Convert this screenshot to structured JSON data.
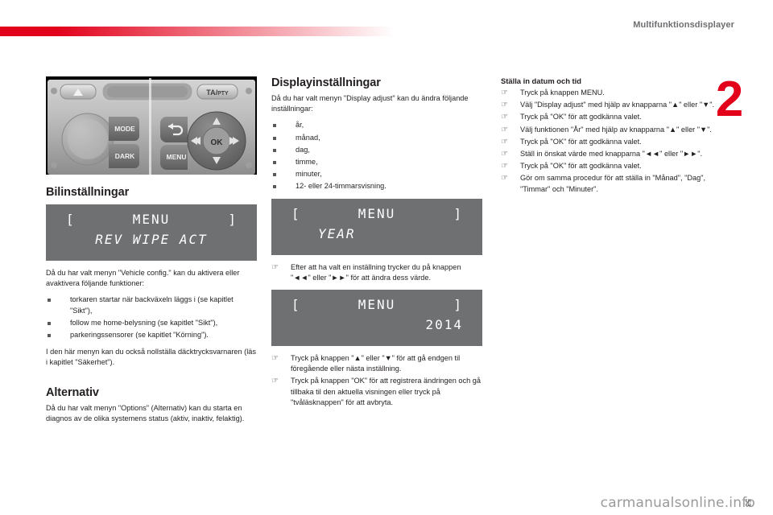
{
  "header": {
    "title": "Multifunktionsdisplayer",
    "chapter": "2"
  },
  "footer": {
    "watermark": "carmanualsonline.info",
    "page_number": "53"
  },
  "radio_panel": {
    "caption": "radio-control-panel-photo",
    "buttons": [
      {
        "label": "TA/PTY",
        "name": "ta-pty-button"
      },
      {
        "label": "MODE",
        "name": "mode-button"
      },
      {
        "label": "DARK",
        "name": "dark-button"
      },
      {
        "label": "MENU",
        "name": "menu-button"
      },
      {
        "label": "OK",
        "name": "ok-button"
      }
    ],
    "icons": [
      "eject-icon",
      "back-arrow-icon",
      "up-arrow-icon",
      "down-arrow-icon",
      "rewind-icon",
      "fast-forward-icon"
    ]
  },
  "left_column": {
    "section_title": "Bilinställningar",
    "lcd": {
      "bracket_left": "[",
      "title": "MENU",
      "bracket_right": "]",
      "line2": "REV WIPE ACT"
    },
    "intro": "Då du har valt menyn \"Vehicle config.\" kan du aktivera eller avaktivera följande funktioner:",
    "bullets": [
      "torkaren startar när backväxeln läggs i (se kapitlet \"Sikt\"),",
      "follow me home-belysning (se kapitlet \"Sikt\"),",
      "parkeringssensorer (se kapitlet \"Körning\")."
    ],
    "outro": "I den här menyn kan du också nollställa däcktrycksvarnaren (läs i kapitlet \"Säkerhet\").",
    "alternativ_title": "Alternativ",
    "alternativ_text": "Då du har valt menyn \"Options\" (Alternativ) kan du starta en diagnos av de olika systemens status (aktiv, inaktiv, felaktig)."
  },
  "middle_column": {
    "section_title": "Displayinställningar",
    "intro": "Då du har valt menyn \"Display adjust\" kan du ändra följande inställningar:",
    "bullets": [
      "år,",
      "månad,",
      "dag,",
      "timme,",
      "minuter,",
      "12- eller 24-timmarsvisning."
    ],
    "lcd_year": {
      "bracket_left": "[",
      "title": "MENU",
      "bracket_right": "]",
      "line2": "YEAR"
    },
    "step_after_lcd_year": "Efter att ha valt en inställning trycker du på knappen \"◄◄\" eller \"►►\" för att ändra dess värde.",
    "lcd_2014": {
      "bracket_left": "[",
      "title": "MENU",
      "bracket_right": "]",
      "line2": "2014"
    },
    "steps": [
      "Tryck på knappen \"▲\" eller \"▼\" för att gå endgen til föregående eller nästa inställning.",
      "Tryck på knappen \"OK\" för att registrera ändringen och gå tillbaka til den aktuella visningen eller tryck på \"tvåläsknappen\" för att avbryta."
    ]
  },
  "right_column": {
    "section_title": "Ställa in datum och tid",
    "steps": [
      "Tryck på knappen MENU.",
      "Välj \"Display adjust\" med hjälp av knapparna \"▲\" eller \"▼\".",
      "Tryck på \"OK\" för att godkänna valet.",
      "Välj funktionen \"År\" med hjälp av knapparna \"▲\" eller \"▼\".",
      "Tryck på \"OK\" för att godkänna valet.",
      "Ställ in önskat värde med knapparna \"◄◄\" eller \"►►\".",
      "Tryck på \"OK\" för att godkänna valet.",
      "Gör om samma procedur för att ställa in \"Månad\", \"Dag\", \"Timmar\" och \"Minuter\"."
    ]
  },
  "icons": {
    "hand": "☞"
  }
}
